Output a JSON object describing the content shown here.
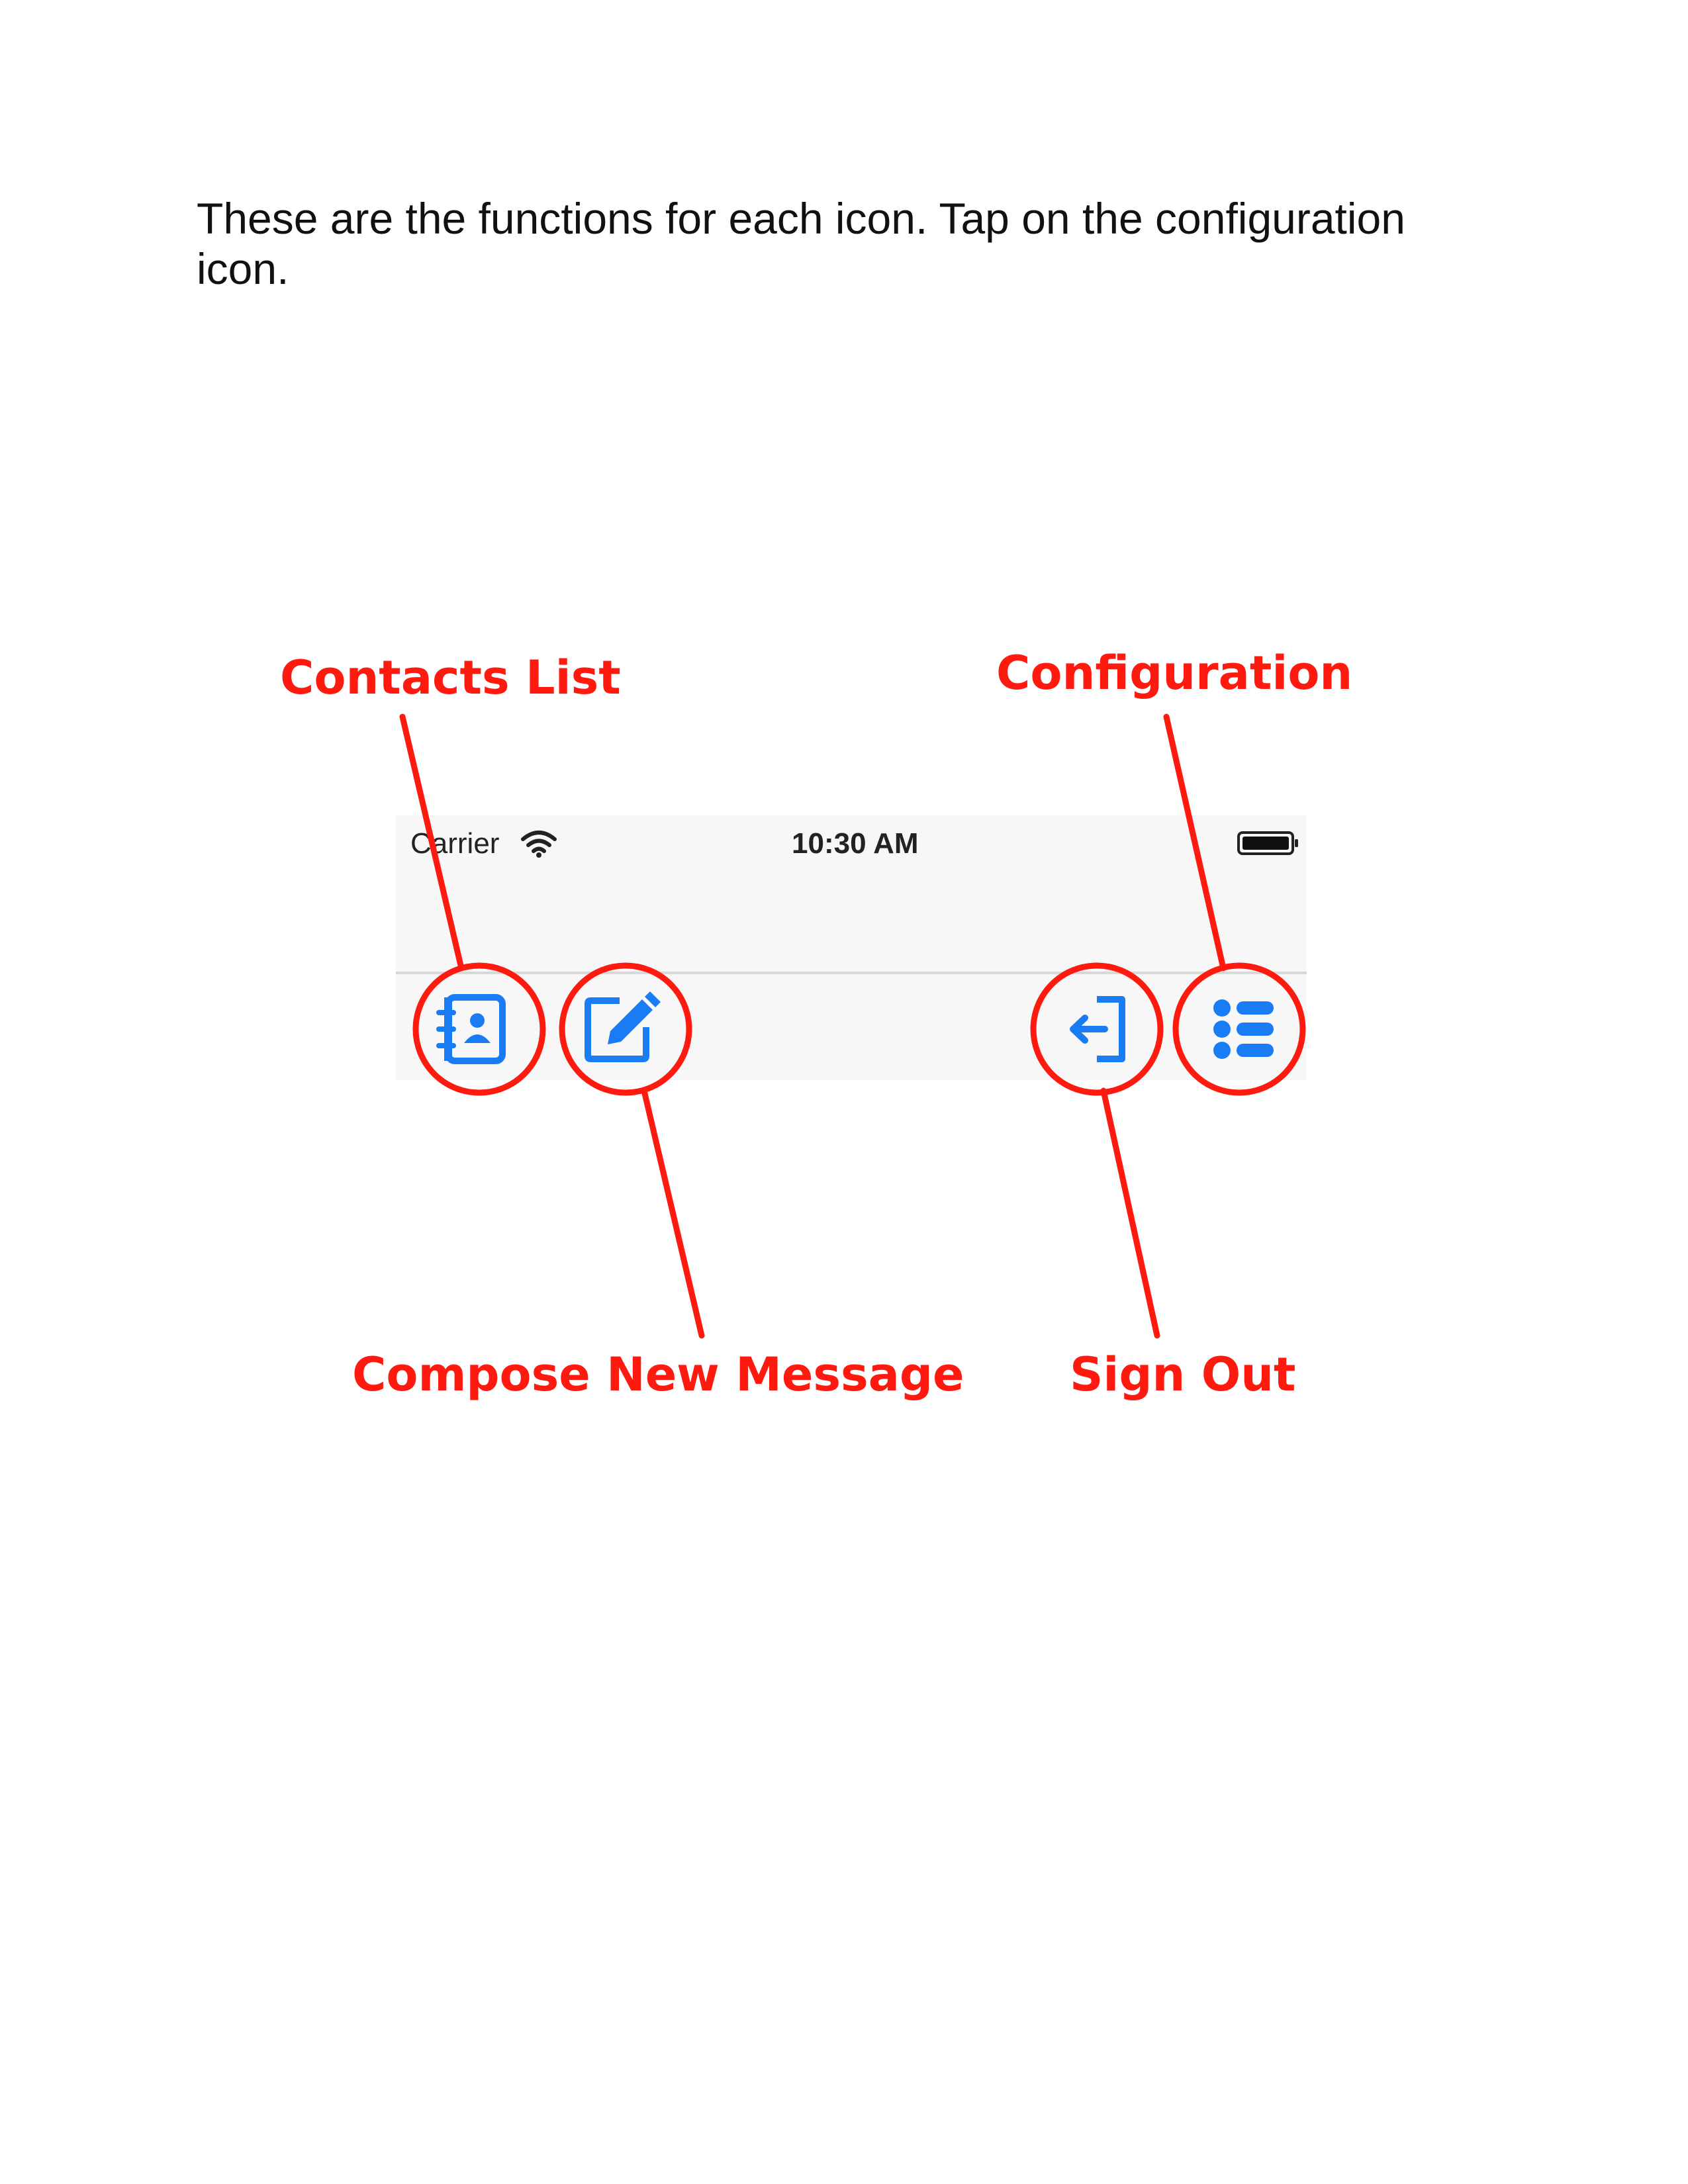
{
  "instruction": {
    "text": "These are the functions for each icon. Tap on the configuration icon."
  },
  "phone": {
    "status_bar": {
      "carrier": "Carrier",
      "time": "10:30 AM"
    },
    "toolbar": {
      "icons": [
        "contacts-book-icon",
        "compose-icon",
        "sign-out-icon",
        "list-icon"
      ],
      "icon_color": "#1a7cf5"
    }
  },
  "callouts": {
    "contacts_list": "Contacts List",
    "configuration": "Configuration",
    "compose_new_message": "Compose New Message",
    "sign_out": "Sign Out",
    "color": "#ff1a0f"
  }
}
